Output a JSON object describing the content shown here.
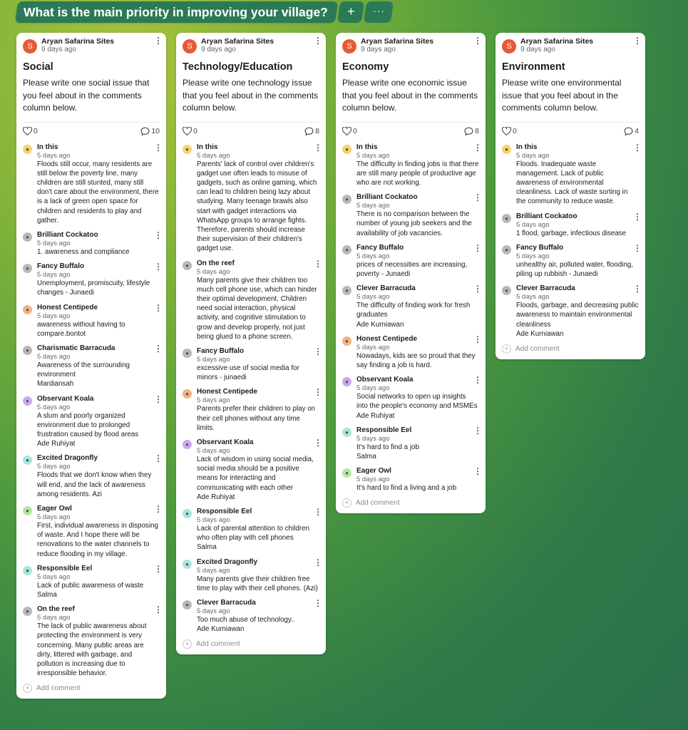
{
  "board": {
    "title": "What is the main priority in improving your village?",
    "add_icon": "+",
    "more_icon": "···"
  },
  "columns": [
    {
      "author": "Aryan Safarina Sites",
      "avatar": "S",
      "time": "9 days ago",
      "title": "Social",
      "body": "Please write one social issue that you feel about in the comments column below.",
      "likes": "0",
      "comment_count": "10",
      "comments": [
        {
          "name": "In this",
          "time": "5 days ago",
          "icon": "sun-icon",
          "color": "#f7d36b",
          "text": "Floods still occur, many residents are still below the poverty line, many children are still stunted, many still don't care about the environment, there is a lack of green open space for children and residents to play and gather."
        },
        {
          "name": "Brilliant Cockatoo",
          "time": "5 days ago",
          "icon": "cockatoo-icon",
          "color": "#b8b8b8",
          "text": "1. awareness and compliance"
        },
        {
          "name": "Fancy Buffalo",
          "time": "5 days ago",
          "icon": "buffalo-icon",
          "color": "#b8b8b8",
          "text": "Unemployment, promiscuity, lifestyle changes - Junaedi"
        },
        {
          "name": "Honest Centipede",
          "time": "5 days ago",
          "icon": "centipede-icon",
          "color": "#f4b183",
          "text": "awareness without having to compare.bontot"
        },
        {
          "name": "Charismatic Barracuda",
          "time": "5 days ago",
          "icon": "barracuda-icon",
          "color": "#b8b8b8",
          "text": "Awareness of the surrounding environment\nMardiansah"
        },
        {
          "name": "Observant Koala",
          "time": "5 days ago",
          "icon": "koala-icon",
          "color": "#c9a9f0",
          "text": "A slum and poorly organized environment due to prolonged frustration caused by flood areas\nAde Ruhiyat"
        },
        {
          "name": "Excited Dragonfly",
          "time": "5 days ago",
          "icon": "dragonfly-icon",
          "color": "#a8e6de",
          "text": "Floods that we don't know when they will end, and the lack of awareness among residents. Azi"
        },
        {
          "name": "Eager Owl",
          "time": "5 days ago",
          "icon": "owl-icon",
          "color": "#b5e8a0",
          "text": "First, individual awareness in disposing of waste. And I hope there will be renovations to the water channels to reduce flooding in my village."
        },
        {
          "name": "Responsible Eel",
          "time": "5 days ago",
          "icon": "eel-icon",
          "color": "#a8e6de",
          "text": "Lack of public awareness of waste\nSalma"
        },
        {
          "name": "On the reef",
          "time": "5 days ago",
          "icon": "reef-icon",
          "color": "#b8b8b8",
          "text": "The lack of public awareness about protecting the environment is very concerning. Many public areas are dirty, littered with garbage, and pollution is increasing due to irresponsible behavior."
        }
      ],
      "add_comment": "Add comment"
    },
    {
      "author": "Aryan Safarina Sites",
      "avatar": "S",
      "time": "9 days ago",
      "title": "Technology/Education",
      "body": "Please write one technology issue that you feel about in the comments column below.",
      "likes": "0",
      "comment_count": "8",
      "comments": [
        {
          "name": "In this",
          "time": "5 days ago",
          "icon": "sun-icon",
          "color": "#f7d36b",
          "text": "Parents' lack of control over children's gadget use often leads to misuse of gadgets, such as online gaming, which can lead to children being lazy about studying. Many teenage brawls also start with gadget interactions via WhatsApp groups to arrange fights. Therefore, parents should increase their supervision of their children's gadget use."
        },
        {
          "name": "On the reef",
          "time": "5 days ago",
          "icon": "reef-icon",
          "color": "#b8b8b8",
          "text": "Many parents give their children too much cell phone use, which can hinder their optimal development. Children need social interaction, physical activity, and cognitive stimulation to grow and develop properly, not just being glued to a phone screen."
        },
        {
          "name": "Fancy Buffalo",
          "time": "5 days ago",
          "icon": "buffalo-icon",
          "color": "#b8b8b8",
          "text": "excessive use of social media for minors - junaedi"
        },
        {
          "name": "Honest Centipede",
          "time": "5 days ago",
          "icon": "centipede-icon",
          "color": "#f4b183",
          "text": "Parents prefer their children to play on their cell phones without any time limits."
        },
        {
          "name": "Observant Koala",
          "time": "5 days ago",
          "icon": "koala-icon",
          "color": "#c9a9f0",
          "text": "Lack of wisdom in using social media, social media should be a positive means for interacting and communicating with each other\nAde Ruhiyat"
        },
        {
          "name": "Responsible Eel",
          "time": "5 days ago",
          "icon": "eel-icon",
          "color": "#a8e6de",
          "text": "Lack of parental attention to children who often play with cell phones\nSalma"
        },
        {
          "name": "Excited Dragonfly",
          "time": "5 days ago",
          "icon": "dragonfly-icon",
          "color": "#a8e6de",
          "text": "Many parents give their children free time to play with their cell phones. (Azi)"
        },
        {
          "name": "Clever Barracuda",
          "time": "5 days ago",
          "icon": "barracuda-icon",
          "color": "#b8b8b8",
          "text": "Too much abuse of technology..\nAde Kurniawan"
        }
      ],
      "add_comment": "Add comment"
    },
    {
      "author": "Aryan Safarina Sites",
      "avatar": "S",
      "time": "9 days ago",
      "title": "Economy",
      "body": "Please write one economic issue that you feel about in the comments column below.",
      "likes": "0",
      "comment_count": "8",
      "comments": [
        {
          "name": "In this",
          "time": "5 days ago",
          "icon": "sun-icon",
          "color": "#f7d36b",
          "text": "The difficulty in finding jobs is that there are still many people of productive age who are not working."
        },
        {
          "name": "Brilliant Cockatoo",
          "time": "5 days ago",
          "icon": "cockatoo-icon",
          "color": "#b8b8b8",
          "text": "There is no comparison between the number of young job seekers and the availability of job vacancies."
        },
        {
          "name": "Fancy Buffalo",
          "time": "5 days ago",
          "icon": "buffalo-icon",
          "color": "#b8b8b8",
          "text": "prices of necessities are increasing, poverty - Junaedi"
        },
        {
          "name": "Clever Barracuda",
          "time": "5 days ago",
          "icon": "barracuda-icon",
          "color": "#b8b8b8",
          "text": "The difficulty of finding work for fresh graduates\nAde Kurniawan\n"
        },
        {
          "name": "Honest Centipede",
          "time": "5 days ago",
          "icon": "centipede-icon",
          "color": "#f4b183",
          "text": "Nowadays, kids are so proud that they say finding a job is hard."
        },
        {
          "name": "Observant Koala",
          "time": "5 days ago",
          "icon": "koala-icon",
          "color": "#c9a9f0",
          "text": "Social networks to open up insights into the people's economy and MSMEs\nAde Ruhiyat"
        },
        {
          "name": "Responsible Eel",
          "time": "5 days ago",
          "icon": "eel-icon",
          "color": "#a8e6de",
          "text": "It's hard to find a job\nSalma"
        },
        {
          "name": "Eager Owl",
          "time": "5 days ago",
          "icon": "owl-icon",
          "color": "#b5e8a0",
          "text": "It's hard to find a living and a job"
        }
      ],
      "add_comment": "Add comment"
    },
    {
      "author": "Aryan Safarina Sites",
      "avatar": "S",
      "time": "9 days ago",
      "title": "Environment",
      "body": "Please write one environmental issue that you feel about in the comments column below.",
      "likes": "0",
      "comment_count": "4",
      "comments": [
        {
          "name": "In this",
          "time": "5 days ago",
          "icon": "sun-icon",
          "color": "#f7d36b",
          "text": "Floods. Inadequate waste management. Lack of public awareness of environmental cleanliness. Lack of waste sorting in the community to reduce waste."
        },
        {
          "name": "Brilliant Cockatoo",
          "time": "5 days ago",
          "icon": "cockatoo-icon",
          "color": "#b8b8b8",
          "text": "1 flood, garbage, infectious disease"
        },
        {
          "name": "Fancy Buffalo",
          "time": "5 days ago",
          "icon": "buffalo-icon",
          "color": "#b8b8b8",
          "text": "unhealthy air, polluted water, flooding, piling up rubbish - Junaedi"
        },
        {
          "name": "Clever Barracuda",
          "time": "5 days ago",
          "icon": "barracuda-icon",
          "color": "#b8b8b8",
          "text": "Floods, garbage, and decreasing public awareness to maintain environmental cleanliness\nAde Kurniawan"
        }
      ],
      "add_comment": "Add comment"
    }
  ]
}
